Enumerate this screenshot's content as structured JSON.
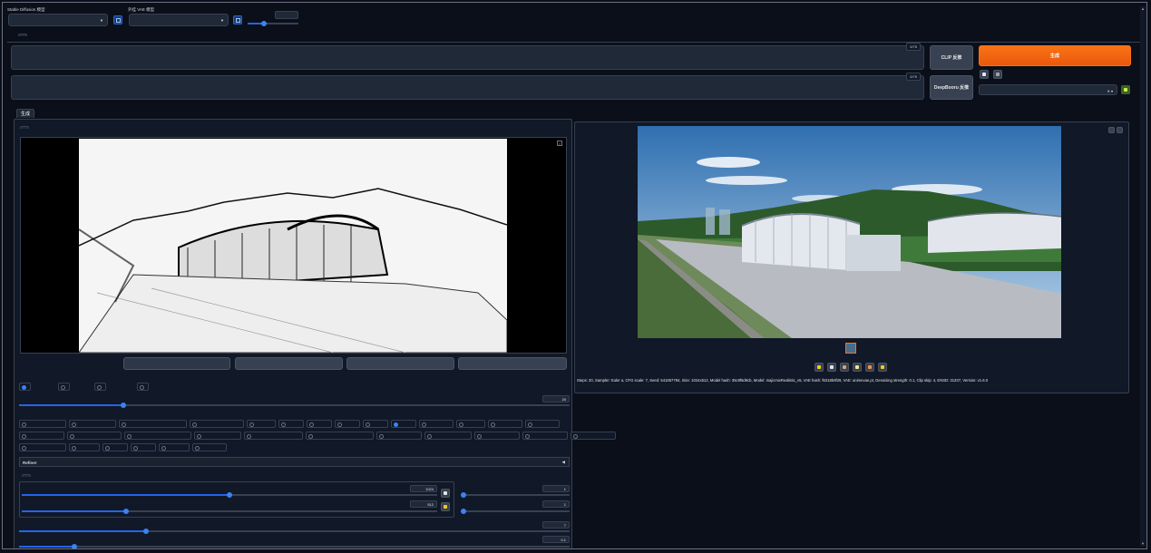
{
  "header": {
    "model_label": "Stable Diffusion 模型",
    "model_value": "",
    "vae_label": "外挂 VAE 模型",
    "vae_value": "",
    "clip_label": "",
    "clip_value": ""
  },
  "main_tabs": [
    "",
    "",
    "",
    "",
    "",
    "",
    "",
    "",
    "",
    "",
    "",
    "",
    ""
  ],
  "prompt": {
    "placeholder": "",
    "count": "0/75"
  },
  "neg_prompt": {
    "placeholder": "",
    "count": "0/75"
  },
  "buttons": {
    "generate": "生成",
    "clip": "CLIP 反推",
    "deepbooru": "DeepBooru 反推"
  },
  "sub_tabs": [
    "生成",
    "",
    "",
    "",
    "",
    ""
  ],
  "img_tabs": [
    "",
    "",
    "",
    "",
    "",
    ""
  ],
  "copy_label": "",
  "action_buttons": [
    "",
    "",
    "",
    ""
  ],
  "resize": {
    "label": "",
    "options": [
      "",
      "",
      "",
      ""
    ]
  },
  "steps": {
    "label": "",
    "value": "20",
    "fraction": 0.19
  },
  "sampler": {
    "label": "",
    "options": [
      "",
      "",
      "",
      "",
      "",
      "",
      "",
      "",
      "",
      "",
      "",
      "",
      "",
      "",
      "",
      "",
      "",
      "",
      "",
      "",
      "",
      "",
      "",
      "",
      "",
      "",
      "",
      "",
      "",
      "",
      "",
      "",
      "",
      "",
      "",
      "",
      "",
      "",
      ""
    ]
  },
  "refiner": {
    "label": "Refiner"
  },
  "size_tabs": [
    "",
    ""
  ],
  "width": {
    "label": "",
    "value": "1024",
    "fraction": 0.5
  },
  "height": {
    "label": "",
    "value": "512",
    "fraction": 0.25
  },
  "batch_count": {
    "label": "",
    "value": "1",
    "fraction": 0.0
  },
  "batch_size": {
    "label": "",
    "value": "1",
    "fraction": 0.0
  },
  "cfg": {
    "label": "",
    "value": "7",
    "fraction": 0.23
  },
  "denoise": {
    "label": "",
    "value": "0.1",
    "fraction": 0.1
  },
  "info": {
    "text": "Steps: 20, Sampler: Euler a, CFG scale: 7, Seed: 541857794, Size: 1024x512, Model hash: 35c9f6d9cb, Model: majicmixRealistic_v5, VAE hash: f6318b9f29, VAE: animevae.pt, Denoising strength: 0.1, Clip skip: 4, ENSD: 31337, Version: v1.6.0",
    "time": "",
    "stats": ""
  },
  "colors": {
    "bg": "#0b0f19",
    "panel": "#111827",
    "accent": "#f97316",
    "blue": "#3b82f6"
  }
}
